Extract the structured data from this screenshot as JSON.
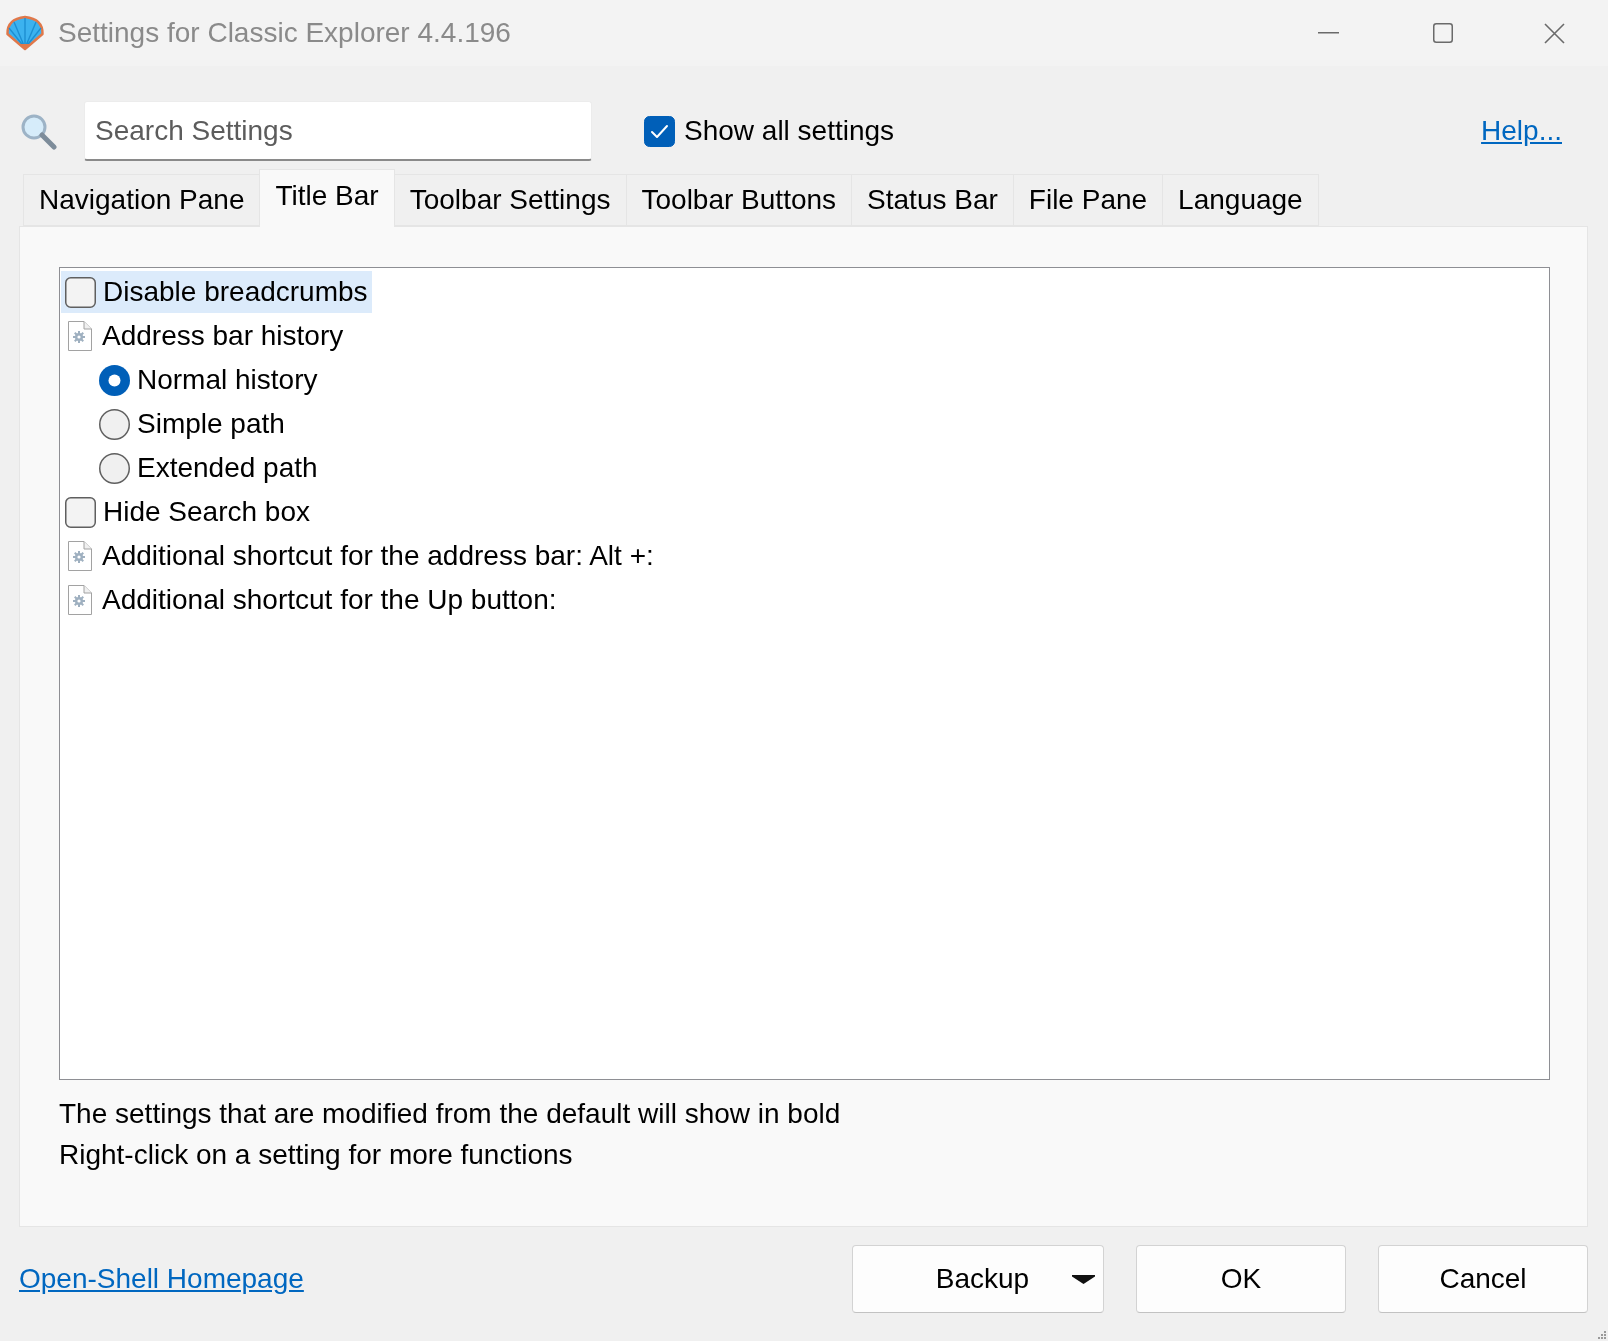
{
  "window": {
    "title": "Settings for Classic Explorer 4.4.196"
  },
  "search": {
    "placeholder": "Search Settings"
  },
  "show_all": {
    "label": "Show all settings",
    "checked": true
  },
  "help_link": "Help...",
  "tabs": [
    {
      "label": "Navigation Pane",
      "selected": false
    },
    {
      "label": "Title Bar",
      "selected": true
    },
    {
      "label": "Toolbar Settings",
      "selected": false
    },
    {
      "label": "Toolbar Buttons",
      "selected": false
    },
    {
      "label": "Status Bar",
      "selected": false
    },
    {
      "label": "File Pane",
      "selected": false
    },
    {
      "label": "Language",
      "selected": false
    }
  ],
  "settings": [
    {
      "kind": "checkbox",
      "label": "Disable breadcrumbs",
      "checked": false,
      "selected": true
    },
    {
      "kind": "group",
      "label": "Address bar history",
      "selected": false,
      "children": [
        {
          "kind": "radio",
          "label": "Normal history",
          "checked": true,
          "selected": false
        },
        {
          "kind": "radio",
          "label": "Simple path",
          "checked": false,
          "selected": false
        },
        {
          "kind": "radio",
          "label": "Extended path",
          "checked": false,
          "selected": false
        }
      ]
    },
    {
      "kind": "checkbox",
      "label": "Hide Search box",
      "checked": false,
      "selected": false
    },
    {
      "kind": "text",
      "label": "Additional shortcut for the address bar: Alt +:",
      "selected": false
    },
    {
      "kind": "text",
      "label": "Additional shortcut for the Up button:",
      "selected": false
    }
  ],
  "notes": [
    "The settings that are modified from the default will show in bold",
    "Right-click on a setting for more functions"
  ],
  "homepage_link": "Open-Shell Homepage",
  "buttons": [
    {
      "label": "Backup",
      "kind": "dropdown"
    },
    {
      "label": "OK",
      "kind": "plain"
    },
    {
      "label": "Cancel",
      "kind": "plain"
    }
  ]
}
